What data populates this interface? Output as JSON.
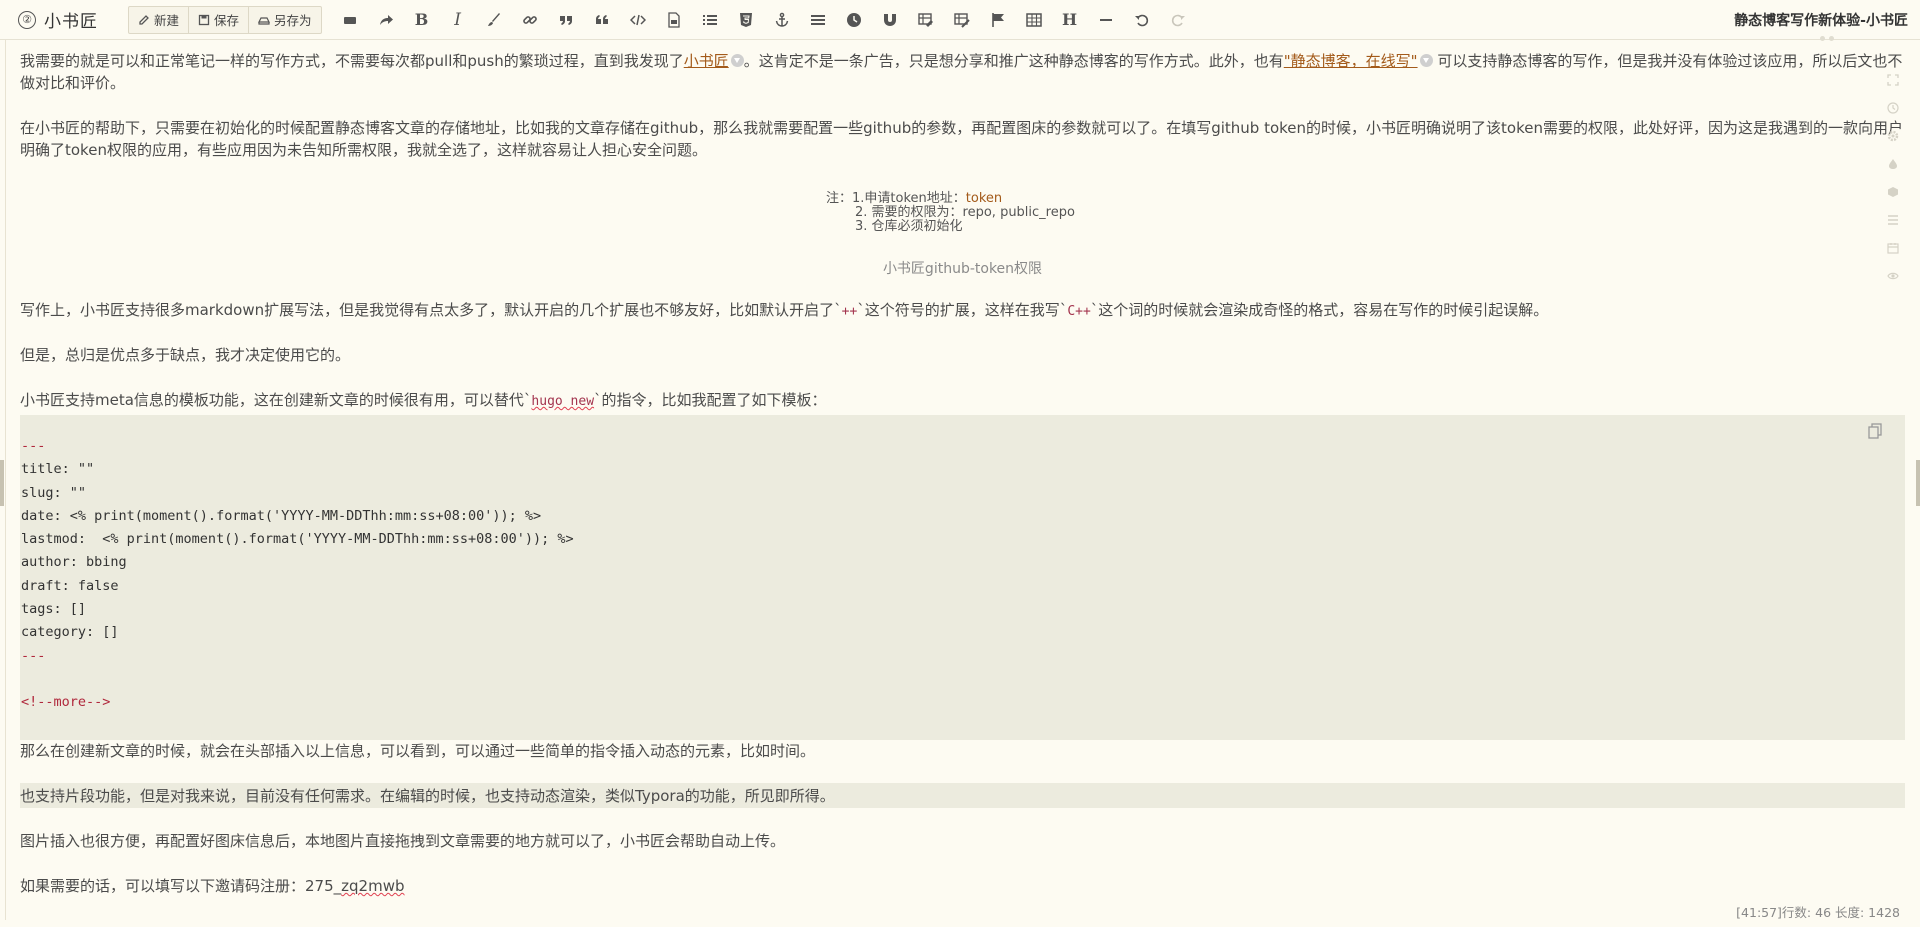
{
  "app": {
    "logo_mark": "②",
    "logo_text": "小书匠",
    "doc_title": "静态博客写作新体验-小书匠"
  },
  "toolbar": {
    "file_buttons": [
      {
        "label": "新建",
        "icon": "new-doc-icon"
      },
      {
        "label": "保存",
        "icon": "save-icon"
      },
      {
        "label": "另存为",
        "icon": "save-as-icon"
      }
    ],
    "tools": [
      "eraser-icon",
      "redo-arrow-icon",
      "bold-icon",
      "italic-icon",
      "brush-icon",
      "link-icon",
      "quote-icon",
      "blockquote-icon",
      "code-icon",
      "file-icon",
      "list-icon",
      "html5-icon",
      "anchor-icon",
      "align-icon",
      "clock-icon",
      "magnet-icon",
      "table-edit-icon",
      "table-tools-icon",
      "flag-icon",
      "table-icon",
      "heading-icon",
      "hr-icon",
      "undo-icon",
      "redo-icon"
    ],
    "bold_glyph": "B",
    "italic_glyph": "I",
    "heading_glyph": "H"
  },
  "content": {
    "p1": {
      "a": "我需要的就是可以和正常笔记一样的写作方式，不需要每次都pull和push的繁琐过程，直到我发现了",
      "link1": "小书匠",
      "b": "。这肯定不是一条广告，只是想分享和推广这种静态博客的写作方式。此外，也有",
      "link2": "\"静态博客，在线写\"",
      "c": " 可以支持静态博客的写作，但是我并没有体验过该应用，所以后文也不做对比和评价。"
    },
    "p2": "在小书匠的帮助下，只需要在初始化的时候配置静态博客文章的存储地址，比如我的文章存储在github，那么我就需要配置一些github的参数，再配置图床的参数就可以了。在填写github token的时候，小书匠明确说明了该token需要的权限，此处好评，因为这是我遇到的一款向用户明确了token权限的应用，有些应用因为未告知所需权限，我就全选了，这样就容易让人担心安全问题。",
    "note": {
      "prefix": "注：",
      "line1": "1.申请token地址：",
      "line1_link": "token",
      "line2": "2. 需要的权限为：repo, public_repo",
      "line3": "3. 仓库必须初始化"
    },
    "caption": "小书匠github-token权限",
    "p3": {
      "a": "写作上，小书匠支持很多markdown扩展写法，但是我觉得有点太多了，默认开启的几个扩展也不够友好，比如默认开启了`",
      "code1": "++",
      "b": "`这个符号的扩展，这样在我写`",
      "code2": "C++",
      "c": "`这个词的时候就会渲染成奇怪的格式，容易在写作的时候引起误解。"
    },
    "p4": "但是，总归是优点多于缺点，我才决定使用它的。",
    "p5": {
      "a": "小书匠支持meta信息的模板功能，这在创建新文章的时候很有用，可以替代`",
      "code": "hugo new",
      "b": "`的指令，比如我配置了如下模板："
    },
    "code_lines": [
      "---",
      "title: \"\"",
      "slug: \"\"",
      "date: <% print(moment().format('YYYY-MM-DDThh:mm:ss+08:00')); %>",
      "lastmod:  <% print(moment().format('YYYY-MM-DDThh:mm:ss+08:00')); %>",
      "author: bbing",
      "draft: false",
      "tags: []",
      "category: []",
      "---",
      "",
      "<!--more-->"
    ],
    "p6": "那么在创建新文章的时候，就会在头部插入以上信息，可以看到，可以通过一些简单的指令插入动态的元素，比如时间。",
    "p7": "也支持片段功能，但是对我来说，目前没有任何需求。在编辑的时候，也支持动态渲染，类似Typora的功能，所见即所得。",
    "p8": "图片插入也很方便，再配置好图床信息后，本地图片直接拖拽到文章需要的地方就可以了，小书匠会帮助自动上传。",
    "p9": {
      "a": "如果需要的话，可以填写以下邀请码注册：275_",
      "code": "zq2mwb"
    }
  },
  "sidebar_icons": [
    "fullscreen-icon",
    "history-icon",
    "settings-icon",
    "drop-icon",
    "cube-icon",
    "toc-icon",
    "calendar-icon",
    "preview-icon"
  ],
  "status": "[41:57]行数: 46 长度: 1428"
}
